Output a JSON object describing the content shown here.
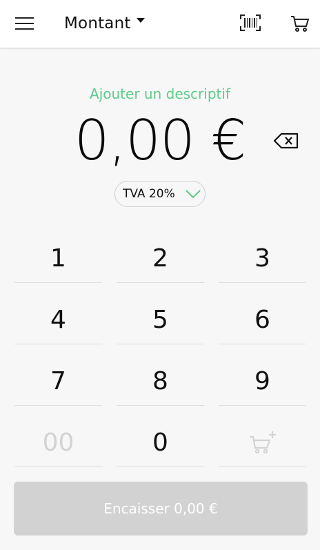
{
  "header": {
    "title": "Montant",
    "menu_icon": "hamburger-menu-icon",
    "barcode_icon": "barcode-scan-icon",
    "cart_icon": "shopping-cart-icon"
  },
  "description": {
    "add_label": "Ajouter un descriptif"
  },
  "amount": {
    "display": "0,00 €",
    "backspace_icon": "backspace-icon"
  },
  "tax": {
    "label": "TVA 20%",
    "chevron_icon": "chevron-down-icon"
  },
  "keypad": {
    "keys": [
      "1",
      "2",
      "3",
      "4",
      "5",
      "6",
      "7",
      "8",
      "9",
      "00",
      "0"
    ],
    "add_to_cart_icon": "cart-plus-icon"
  },
  "checkout": {
    "label": "Encaisser 0,00 €"
  },
  "colors": {
    "accent_green": "#5ccc8a",
    "disabled_gray": "#d2d2d2"
  }
}
